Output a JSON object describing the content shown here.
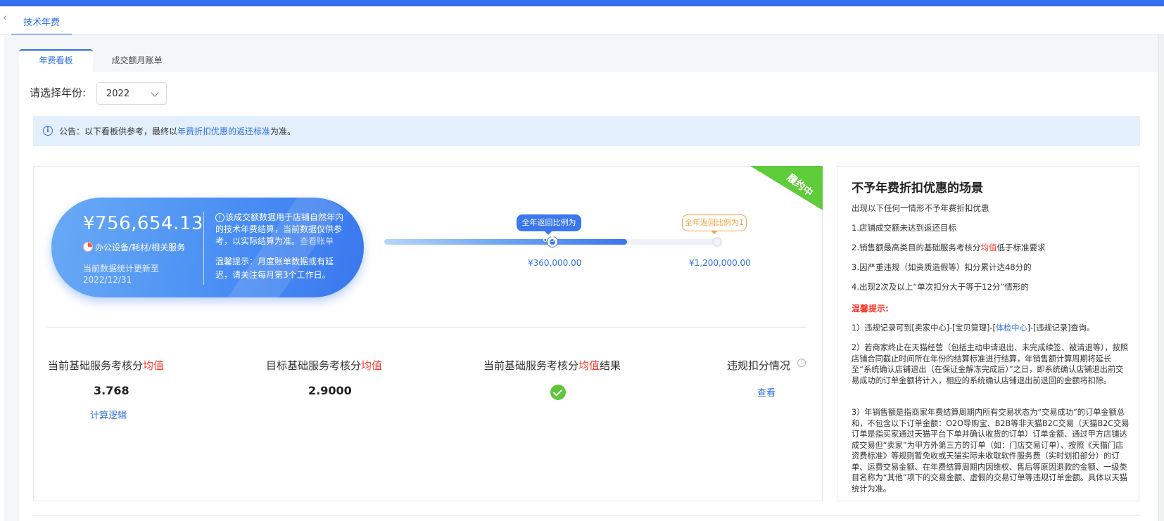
{
  "page_tab": "技术年费",
  "subtabs": [
    "年费看板",
    "成交额月账单"
  ],
  "year_selector": {
    "label": "请选择年份:",
    "value": "2022"
  },
  "notice": {
    "prefix": "公告：以下看板供参考，最终以",
    "link": "年费折扣优惠的返还标准",
    "suffix": "为准。"
  },
  "status_ribbon": "履约中",
  "summary": {
    "amount": "¥756,654.13",
    "category": "办公设备/耗材/相关服务",
    "updated_label": "当前数据统计更新至",
    "updated_date": "2022/12/31",
    "info_text": "该成交额数据用于店铺自然年内的技术年费结算，当前数据仅供参考，以实际结算为准。",
    "bill_link": "查看账单",
    "tip": "温馨提示：月度账单数据或有延迟，请关注每月第3个工作日。"
  },
  "progress": {
    "fill_fraction": 0.73,
    "milestones": [
      {
        "tag": "全年返回比例为0.5",
        "value": "¥360,000.00"
      },
      {
        "tag": "全年返回比例为1",
        "value": "¥1,200,000.00"
      }
    ]
  },
  "metrics": [
    {
      "title_prefix": "当前基础服务考核分",
      "title_red": "均值",
      "title_suffix": "",
      "value": "3.768",
      "link": "计算逻辑"
    },
    {
      "title_prefix": "目标基础服务考核分",
      "title_red": "均值",
      "title_suffix": "",
      "value": "2.9000"
    },
    {
      "title_prefix": "当前基础服务考核分",
      "title_red": "均值",
      "title_suffix": "结果",
      "result": "passed"
    },
    {
      "title_prefix": "违规扣分情况",
      "title_red": "",
      "title_suffix": "",
      "link": "查看"
    }
  ],
  "side": {
    "title": "不予年费折扣优惠的场景",
    "intro": "出现以下任何一情形不予年费折扣优惠",
    "rules": [
      "1.店铺成交额未达到返还目标",
      {
        "prefix": "2.销售额最高类目的基础服务考核分",
        "red": "均值",
        "suffix": "低于标准要求"
      },
      "3.因严重违规（如资质造假等）扣分累计达48分的",
      "4.出现2次及以上“单次扣分大于等于12分”情形的"
    ],
    "warm_tip": "温馨提示:",
    "note1": {
      "prefix": "1）违规记录可到[卖家中心]-[宝贝管理]-[",
      "link": "体检中心",
      "suffix": "]-[违规记录]查询。"
    },
    "note2": "2）若商家终止在天猫经营（包括主动申请退出、未完成续签、被清退等），按照店铺合同截止时间所在年份的结算标准进行结算，年销售额计算周期将延长至“系统确认店铺退出（在保证金解冻完成后）”之日，即系统确认店铺退出前交易成功的订单金额将计入，相应的系统确认店铺退出前退回的金额将扣除。",
    "note3": "3）年销售额是指商家年费结算周期内所有交易状态为“交易成功”的订单金额总和，不包含以下订单金额：O2O导购宝、B2B等非天猫B2C交易（天猫B2C交易订单是指买家通过天猫平台下单并确认收货的订单）订单金额、通过甲方店铺达成交易但“卖家”为甲方外第三方的订单（如：门店交易订单）、按照《天猫门店资费标准》等规则暂免收或天猫实际未收取软件服务费（实时划扣部分）的订单、运费交易金额、在年费结算周期内因维权、售后等原因退款的金额、一级类目名称为“其他”项下的交易金额、虚假的交易订单等违规订单金额。具体以天猫统计为准。"
  },
  "colors": {
    "primary": "#2f6fe8",
    "topbar": "#3270f0",
    "success": "#5ec53a",
    "danger": "#ff3b2f",
    "warning": "#f3a23a"
  }
}
